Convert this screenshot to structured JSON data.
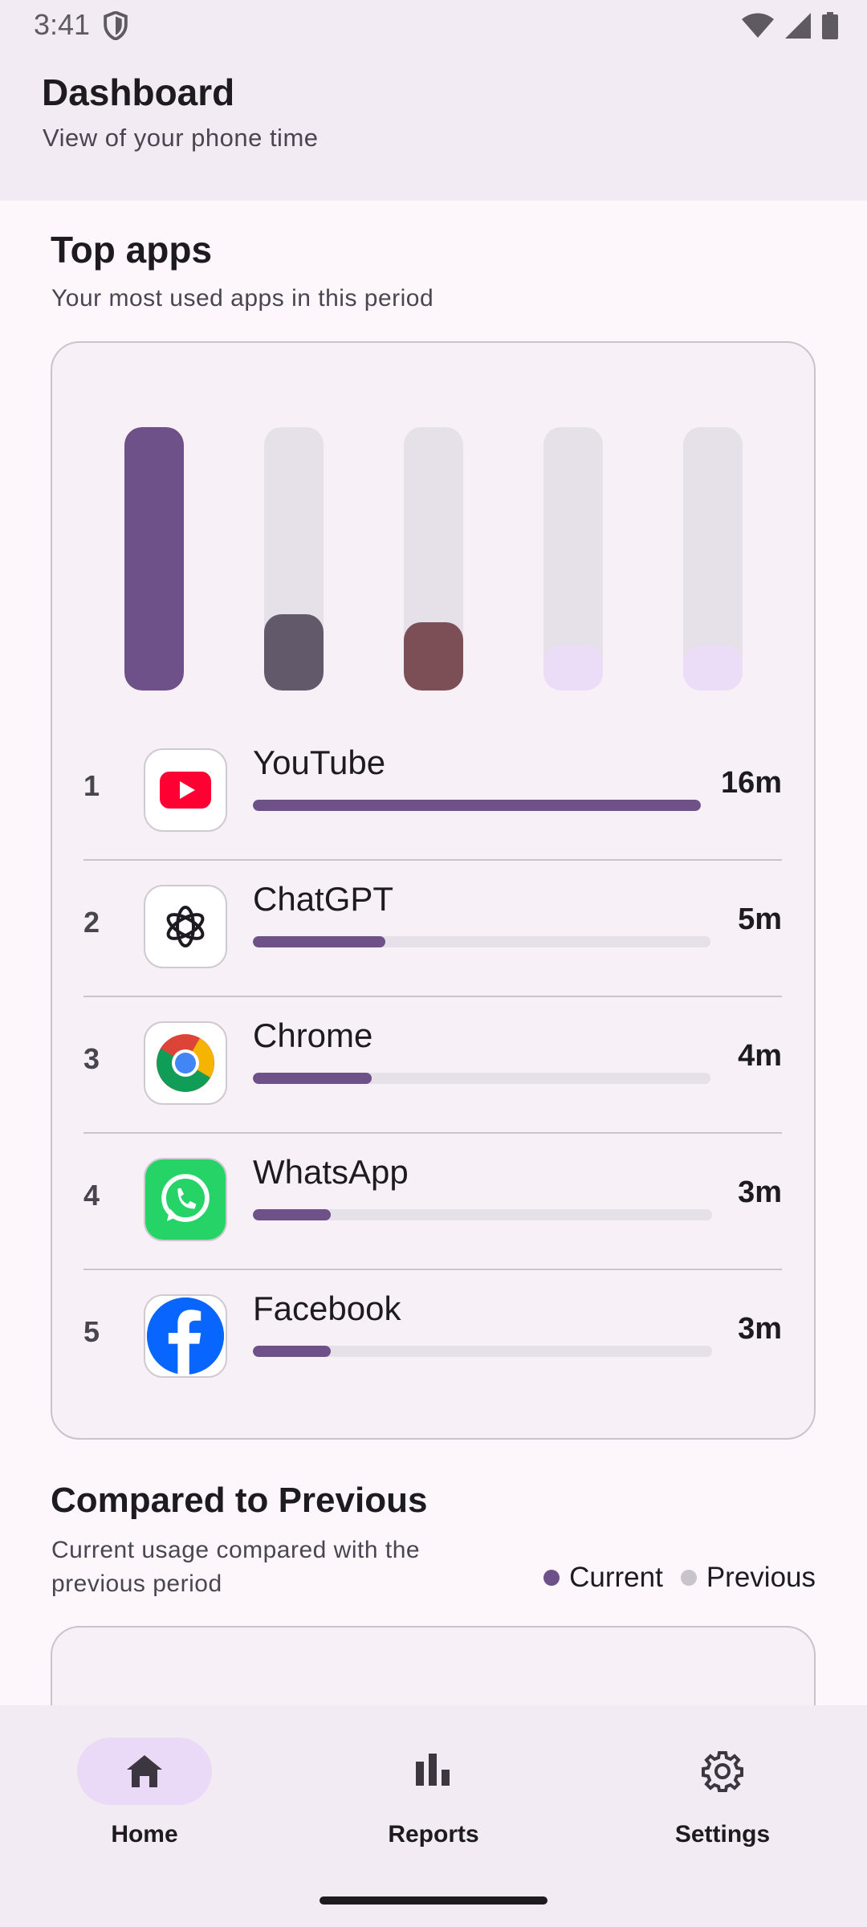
{
  "status_bar": {
    "time": "3:41"
  },
  "header": {
    "title": "Dashboard",
    "subtitle": "View of your phone time"
  },
  "top_apps": {
    "title": "Top apps",
    "subtitle": "Your most used apps in this period",
    "bars": [
      {
        "level": 1.0,
        "color": "#6f5189"
      },
      {
        "level": 0.29,
        "color": "#625a6a"
      },
      {
        "level": 0.26,
        "color": "#7c4f57"
      },
      {
        "level": 0.17,
        "color": "#ebdcf8"
      },
      {
        "level": 0.17,
        "color": "#ebdcf8"
      }
    ],
    "apps": [
      {
        "rank": "1",
        "name": "YouTube",
        "time": "16m",
        "progress": 1.0,
        "icon": "youtube-icon"
      },
      {
        "rank": "2",
        "name": "ChatGPT",
        "time": "5m",
        "progress": 0.29,
        "icon": "chatgpt-icon"
      },
      {
        "rank": "3",
        "name": "Chrome",
        "time": "4m",
        "progress": 0.26,
        "icon": "chrome-icon"
      },
      {
        "rank": "4",
        "name": "WhatsApp",
        "time": "3m",
        "progress": 0.17,
        "icon": "whatsapp-icon"
      },
      {
        "rank": "5",
        "name": "Facebook",
        "time": "3m",
        "progress": 0.17,
        "icon": "facebook-icon"
      }
    ]
  },
  "compare": {
    "title": "Compared to Previous",
    "subtitle_line1": "Current usage compared with the",
    "subtitle_line2": "previous period",
    "legend": {
      "current": "Current",
      "previous": "Previous",
      "current_color": "#6e5189",
      "previous_color": "#c9c3cc"
    }
  },
  "nav": {
    "home": "Home",
    "reports": "Reports",
    "settings": "Settings"
  }
}
